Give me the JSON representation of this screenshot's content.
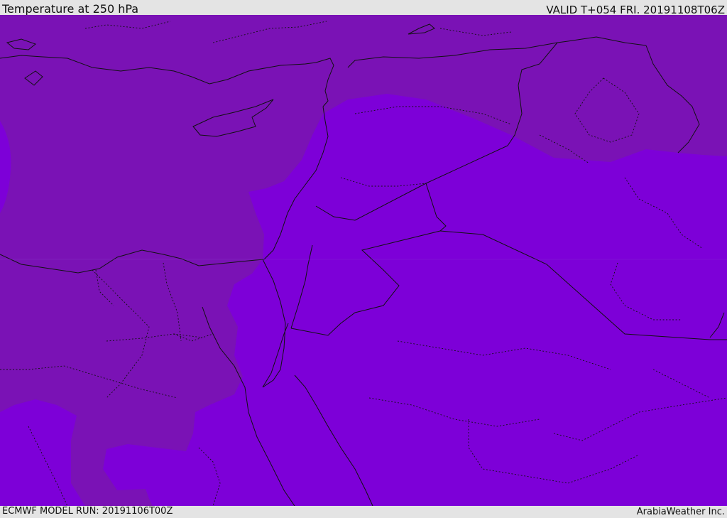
{
  "header": {
    "title": "Temperature at 250 hPa",
    "valid_time": "VALID T+054 FRI. 20191108T06Z"
  },
  "footer": {
    "model_run": "ECMWF MODEL RUN: 20191106T00Z",
    "credit": "ArabiaWeather Inc."
  },
  "map": {
    "variable": "temperature",
    "level": "250 hPa",
    "colors": {
      "cooler_band": "#7a12b5",
      "warmer_band": "#7d00d8",
      "coastline": "#111111",
      "border": "#111111"
    }
  }
}
